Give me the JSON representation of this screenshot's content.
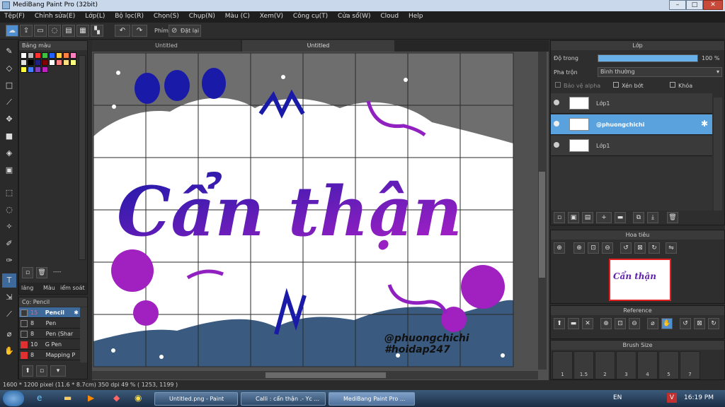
{
  "window": {
    "title": "MediBang Paint Pro (32bit)",
    "min": "–",
    "max": "□",
    "close": "✕"
  },
  "menu": [
    "Tệp(F)",
    "Chỉnh sửa(E)",
    "Lớp(L)",
    "Bộ lọc(R)",
    "Chọn(S)",
    "Chụp(N)",
    "Màu (C)",
    "Xem(V)",
    "Công cụ(T)",
    "Cửa sổ(W)",
    "Cloud",
    "Help"
  ],
  "toolbar": {
    "phim_label": "Phím",
    "undo_label": "Đặt lại"
  },
  "tabs": [
    "Untitled",
    "Untitled"
  ],
  "palette_panel": {
    "title": "Bảng màu",
    "tabs": [
      "lảng",
      "Màu",
      "iểm soát"
    ],
    "dashes": "----"
  },
  "palette_colors": [
    "#ffffff",
    "#b8b8b8",
    "#ff3030",
    "#40c040",
    "#2060ff",
    "#ffd040",
    "#ff8040",
    "#ff80c0",
    "#e0e0e0",
    "#000000",
    "#202080",
    "#800000",
    "#ffffff",
    "#ff8080",
    "#ffe080",
    "#ffff80",
    "#ffff40",
    "#4080ff",
    "#8040c0",
    "#c020c0"
  ],
  "brush_panel": {
    "title": "Cọ: Pencil",
    "items": [
      {
        "size": "15",
        "name": "Pencil",
        "color": "#3a3a3a",
        "selected": true
      },
      {
        "size": "8",
        "name": "Pen",
        "color": "#303030",
        "selected": false
      },
      {
        "size": "8",
        "name": "Pen (Shar",
        "color": "#303030",
        "selected": false
      },
      {
        "size": "10",
        "name": "G Pen",
        "color": "#e03030",
        "selected": false
      },
      {
        "size": "8",
        "name": "Mapping P",
        "color": "#e03030",
        "selected": false
      }
    ]
  },
  "canvas_text": {
    "main": "Cẩn thận",
    "handle1": "@phuongchichi",
    "handle2": "#hoidap247"
  },
  "layer_panel": {
    "title": "Lớp",
    "opacity_label": "Độ trong",
    "opacity_value": "100 %",
    "opacity_fraction": 1.0,
    "blend_label": "Pha trộn",
    "blend_value": "Bình thường",
    "protect_alpha": "Bảo vệ alpha",
    "clip": "Xén bớt",
    "lock": "Khóa",
    "layers": [
      {
        "name": "Lớp1",
        "selected": false
      },
      {
        "name": "@phuongchichi",
        "selected": true
      },
      {
        "name": "Lớp1",
        "selected": false
      }
    ]
  },
  "navigator": {
    "title": "Hoa tiêu"
  },
  "reference": {
    "title": "Reference"
  },
  "brush_size": {
    "title": "Brush Size",
    "values": [
      "1",
      "1.5",
      "2",
      "3",
      "4",
      "5",
      "7"
    ]
  },
  "status": {
    "text": "1600 * 1200 pixel  (11.6 * 8.7cm)  350 dpi  49 %  ( 1253, 1199 )"
  },
  "taskbar": {
    "items": [
      "Untitled.png - Paint",
      "Calli : cẩn thận .- Yc ...",
      "MediBang Paint Pro ..."
    ],
    "lang": "EN",
    "time": "16:19 PM"
  },
  "colors": {
    "accent": "#4f8fd0",
    "canvas_gradient_start": "#1a1aa0",
    "canvas_gradient_end": "#a020c0",
    "sky": "#6e6e6e",
    "ground": "#3a5a80"
  }
}
